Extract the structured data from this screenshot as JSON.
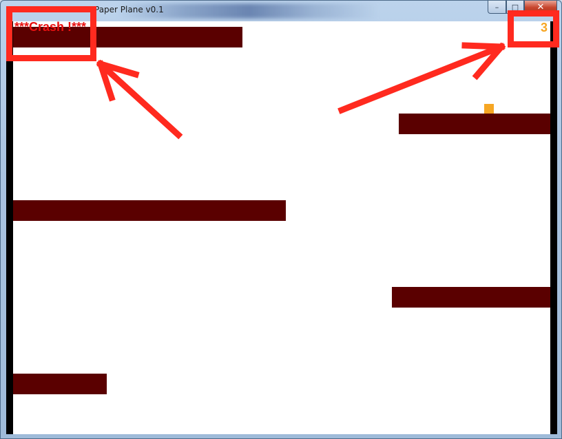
{
  "window": {
    "app_icon": "paper-plane-app-icon",
    "title": "Paper Plane v0.1",
    "buttons": {
      "minimize": "–",
      "maximize": "□",
      "close": "✕"
    }
  },
  "game": {
    "crash_message": "***Crash !***",
    "score": "3",
    "colors": {
      "background": "#ffffff",
      "walls": "#000000",
      "obstacles": "#5a0000",
      "plane": "#f6a623",
      "crash_text": "#e81010",
      "score_text": "#f6a623"
    }
  },
  "annotations": {
    "highlight_color": "#ff2a1f",
    "targets": [
      "crash-message",
      "score"
    ]
  }
}
